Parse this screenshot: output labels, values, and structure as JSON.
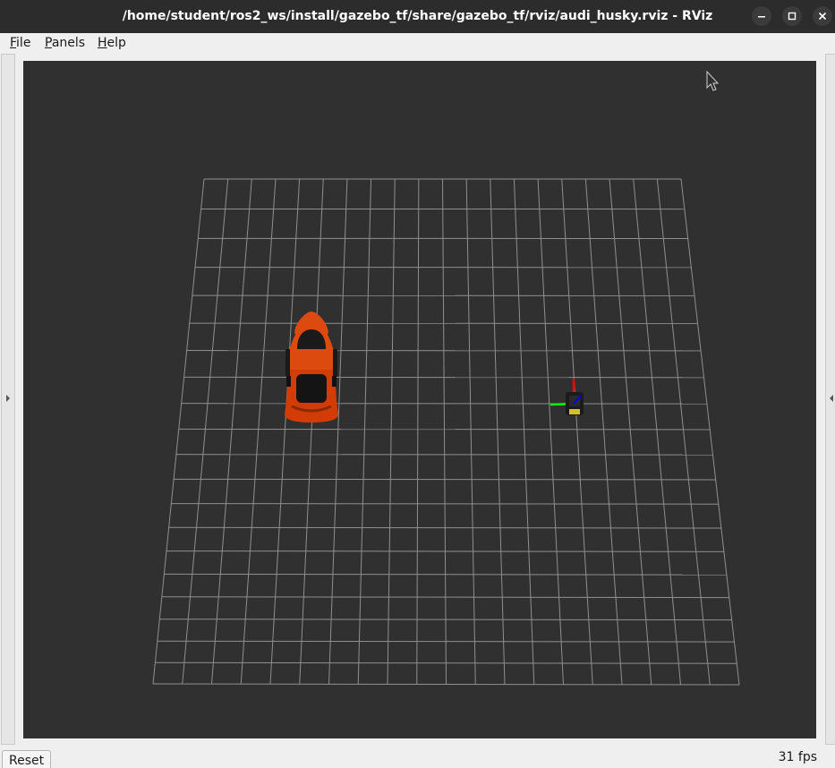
{
  "window": {
    "title": "/home/student/ros2_ws/install/gazebo_tf/share/gazebo_tf/rviz/audi_husky.rviz - RViz",
    "controls": [
      "minimize-icon",
      "maximize-icon",
      "close-icon"
    ]
  },
  "menubar": {
    "file": {
      "mnemonic": "F",
      "rest": "ile"
    },
    "panels": {
      "mnemonic": "P",
      "rest": "anels"
    },
    "help": {
      "mnemonic": "H",
      "rest": "elp"
    }
  },
  "viewport": {
    "background": "#303030",
    "grid_color": "#a0a0a0",
    "grid_cells": 20,
    "objects": [
      "orange-car-model",
      "husky-robot-model"
    ],
    "car_color": "#d23c06",
    "axis_colors": {
      "x": "#ff0000",
      "y": "#00ff00",
      "z": "#0000ff"
    }
  },
  "statusbar": {
    "reset_label": "Reset",
    "fps_label": "31 fps"
  }
}
